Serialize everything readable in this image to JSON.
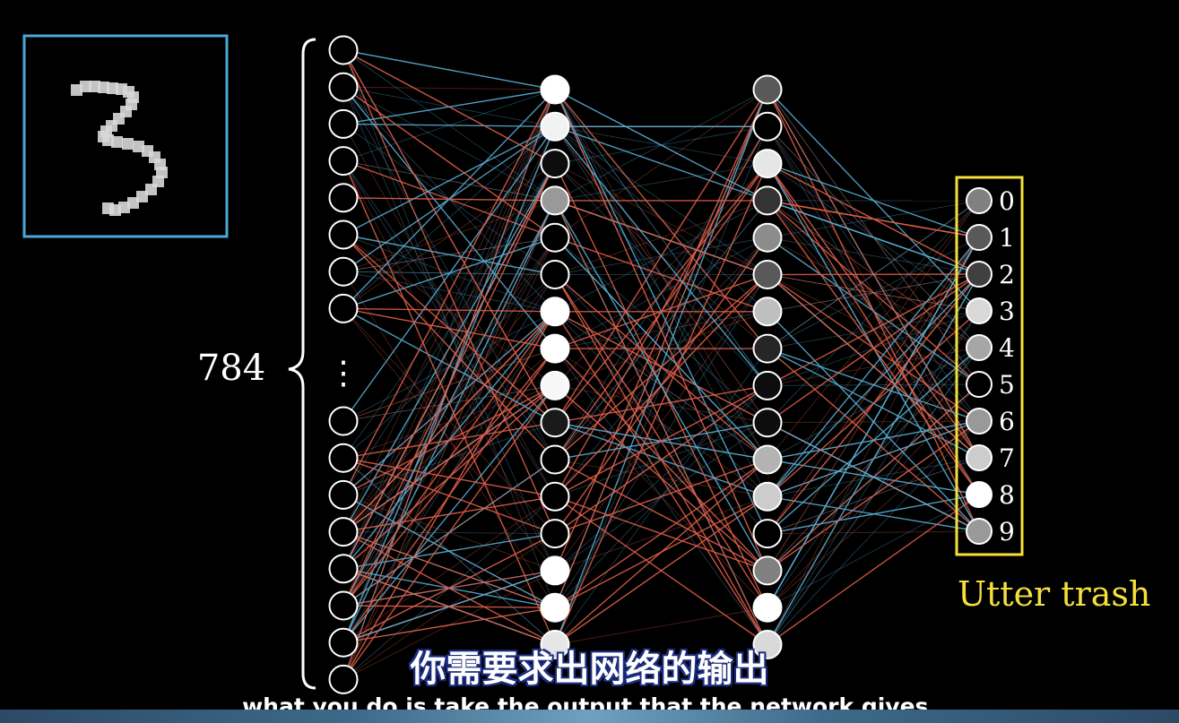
{
  "input_count_label": "784",
  "input_dots": "⋮",
  "output_annotation": "Utter trash",
  "output_labels": [
    "0",
    "1",
    "2",
    "3",
    "4",
    "5",
    "6",
    "7",
    "8",
    "9"
  ],
  "subtitle_zh": "你需要求出网络的输出",
  "subtitle_en": "what you do is take the output that the network gives,",
  "colors": {
    "input_box_border": "#4aa8d8",
    "output_box_border": "#f5e03a",
    "edge_positive": "#5bb3d9",
    "edge_negative": "#e8604a",
    "annotation": "#f5e03a"
  },
  "digit_shown": "3",
  "hidden1_activations": [
    1.0,
    0.95,
    0.05,
    0.6,
    0.0,
    0.0,
    1.0,
    1.0,
    0.97,
    0.1,
    0.0,
    0.0,
    0.0,
    1.0,
    1.0,
    0.9
  ],
  "hidden2_activations": [
    0.35,
    0.0,
    0.9,
    0.2,
    0.55,
    0.35,
    0.75,
    0.15,
    0.05,
    0.05,
    0.7,
    0.8,
    0.0,
    0.5,
    1.0,
    0.85
  ],
  "output_activations": [
    0.5,
    0.35,
    0.25,
    0.85,
    0.65,
    0.0,
    0.6,
    0.8,
    1.0,
    0.6
  ]
}
